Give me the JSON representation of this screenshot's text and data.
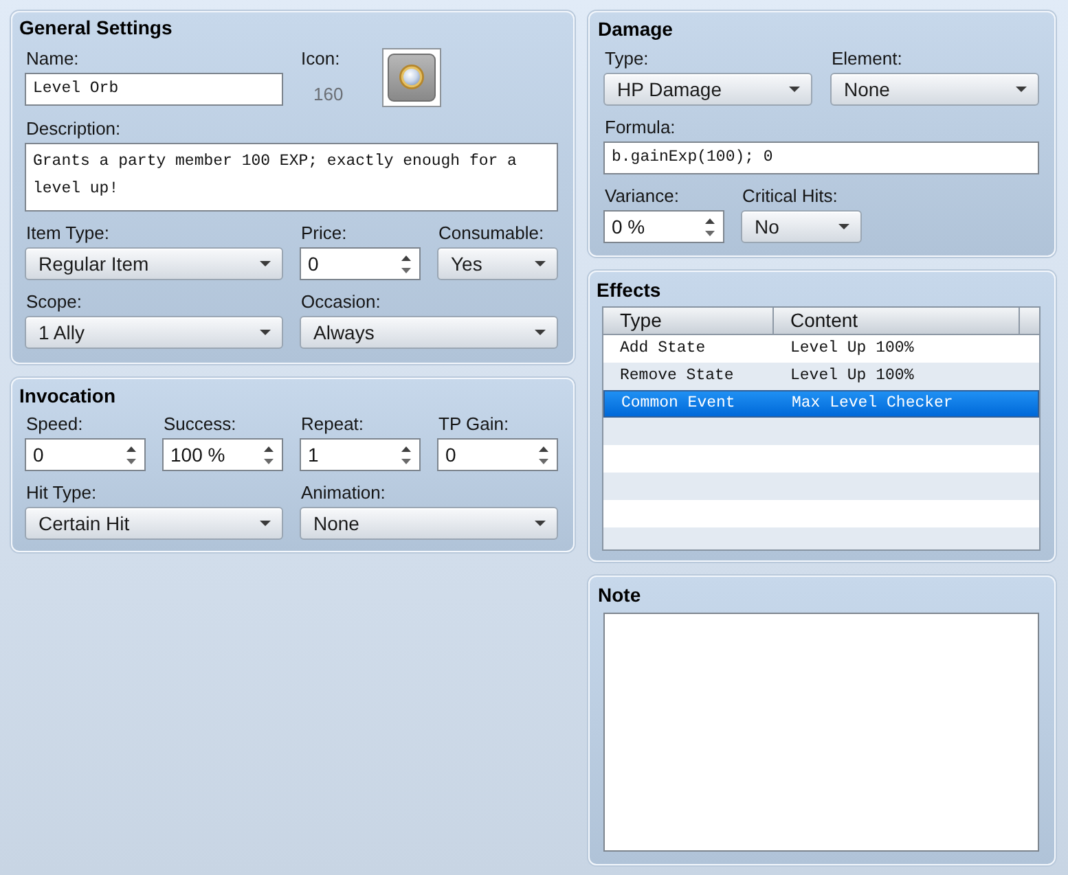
{
  "general_settings": {
    "title": "General Settings",
    "name": {
      "label": "Name:",
      "value": "Level Orb"
    },
    "icon": {
      "label": "Icon:",
      "number": "160"
    },
    "description": {
      "label": "Description:",
      "value": "Grants a party member 100 EXP; exactly enough for a level up!"
    },
    "item_type": {
      "label": "Item Type:",
      "value": "Regular Item"
    },
    "price": {
      "label": "Price:",
      "value": "0"
    },
    "consumable": {
      "label": "Consumable:",
      "value": "Yes"
    },
    "scope": {
      "label": "Scope:",
      "value": "1 Ally"
    },
    "occasion": {
      "label": "Occasion:",
      "value": "Always"
    }
  },
  "invocation": {
    "title": "Invocation",
    "speed": {
      "label": "Speed:",
      "value": "0"
    },
    "success": {
      "label": "Success:",
      "value": "100 %"
    },
    "repeat": {
      "label": "Repeat:",
      "value": "1"
    },
    "tp_gain": {
      "label": "TP Gain:",
      "value": "0"
    },
    "hit_type": {
      "label": "Hit Type:",
      "value": "Certain Hit"
    },
    "animation": {
      "label": "Animation:",
      "value": "None"
    }
  },
  "damage": {
    "title": "Damage",
    "type": {
      "label": "Type:",
      "value": "HP Damage"
    },
    "element": {
      "label": "Element:",
      "value": "None"
    },
    "formula": {
      "label": "Formula:",
      "value": "b.gainExp(100); 0"
    },
    "variance": {
      "label": "Variance:",
      "value": "0 %"
    },
    "critical_hits": {
      "label": "Critical Hits:",
      "value": "No"
    }
  },
  "effects": {
    "title": "Effects",
    "columns": [
      "Type",
      "Content"
    ],
    "rows": [
      {
        "type": "Add State",
        "content": "Level Up 100%",
        "selected": false
      },
      {
        "type": "Remove State",
        "content": "Level Up 100%",
        "selected": false
      },
      {
        "type": "Common Event",
        "content": "Max Level Checker",
        "selected": true
      }
    ]
  },
  "note": {
    "title": "Note"
  }
}
